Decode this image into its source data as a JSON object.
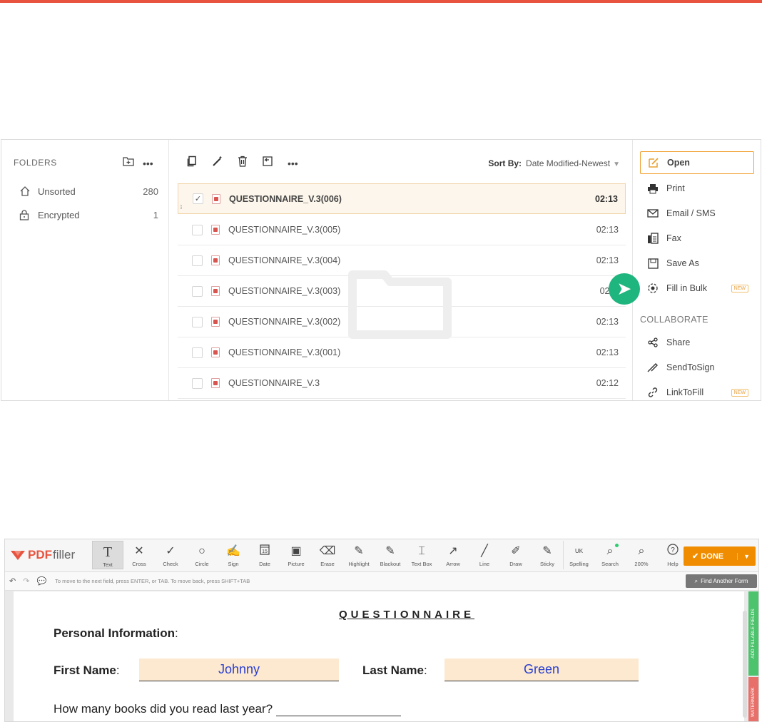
{
  "file_manager": {
    "folders_header": "FOLDERS",
    "folders": [
      {
        "icon": "home-icon",
        "label": "Unsorted",
        "count": "280"
      },
      {
        "icon": "lock-icon",
        "label": "Encrypted",
        "count": "1"
      }
    ],
    "sort_by_label": "Sort By:",
    "sort_by_value": "Date Modified-Newest",
    "files": [
      {
        "name": "QUESTIONNAIRE_V.3(006)",
        "time": "02:13",
        "selected": true
      },
      {
        "name": "QUESTIONNAIRE_V.3(005)",
        "time": "02:13",
        "selected": false
      },
      {
        "name": "QUESTIONNAIRE_V.3(004)",
        "time": "02:13",
        "selected": false
      },
      {
        "name": "QUESTIONNAIRE_V.3(003)",
        "time": "02:",
        "selected": false
      },
      {
        "name": "QUESTIONNAIRE_V.3(002)",
        "time": "02:13",
        "selected": false
      },
      {
        "name": "QUESTIONNAIRE_V.3(001)",
        "time": "02:13",
        "selected": false
      },
      {
        "name": "QUESTIONNAIRE_V.3",
        "time": "02:12",
        "selected": false
      }
    ],
    "actions": [
      {
        "icon": "edit-icon",
        "label": "Open"
      },
      {
        "icon": "print-icon",
        "label": "Print"
      },
      {
        "icon": "email-icon",
        "label": "Email / SMS"
      },
      {
        "icon": "fax-icon",
        "label": "Fax"
      },
      {
        "icon": "save-icon",
        "label": "Save As"
      },
      {
        "icon": "bulk-icon",
        "label": "Fill in Bulk",
        "badge": "NEW"
      }
    ],
    "collaborate_label": "COLLABORATE",
    "collab_actions": [
      {
        "icon": "share-icon",
        "label": "Share"
      },
      {
        "icon": "sign-icon",
        "label": "SendToSign"
      },
      {
        "icon": "link-icon",
        "label": "LinkToFill",
        "badge": "NEW"
      }
    ],
    "accent_color": "#f0a030",
    "highlight_color": "#1fb57e"
  },
  "editor": {
    "logo_pdf": "PDF",
    "logo_filler": "filler",
    "tools": [
      {
        "glyph": "T",
        "label": "Text",
        "icon": "text-icon"
      },
      {
        "glyph": "✕",
        "label": "Cross",
        "icon": "cross-icon"
      },
      {
        "glyph": "✓",
        "label": "Check",
        "icon": "check-icon"
      },
      {
        "glyph": "○",
        "label": "Circle",
        "icon": "circle-icon"
      },
      {
        "glyph": "✍",
        "label": "Sign",
        "icon": "sign-icon"
      },
      {
        "glyph": "📅",
        "label": "Date",
        "icon": "date-icon"
      },
      {
        "glyph": "▣",
        "label": "Picture",
        "icon": "picture-icon"
      },
      {
        "glyph": "⌫",
        "label": "Erase",
        "icon": "erase-icon"
      },
      {
        "glyph": "✎",
        "label": "Highlight",
        "icon": "highlight-icon"
      },
      {
        "glyph": "✎",
        "label": "Blackout",
        "icon": "blackout-icon"
      },
      {
        "glyph": "⌶",
        "label": "Text Box",
        "icon": "textbox-icon"
      },
      {
        "glyph": "↗",
        "label": "Arrow",
        "icon": "arrow-icon"
      },
      {
        "glyph": "╱",
        "label": "Line",
        "icon": "line-icon"
      },
      {
        "glyph": "✐",
        "label": "Draw",
        "icon": "draw-icon"
      },
      {
        "glyph": "✎",
        "label": "Sticky",
        "icon": "sticky-icon"
      },
      {
        "glyph": "UK",
        "label": "Spelling",
        "icon": "spelling-icon"
      },
      {
        "glyph": "⌕",
        "label": "Search",
        "icon": "search-icon"
      },
      {
        "glyph": "⌕",
        "label": "200%",
        "icon": "zoom-icon"
      },
      {
        "glyph": "?",
        "label": "Help",
        "icon": "help-icon"
      }
    ],
    "done_label": "✔ DONE",
    "hint": "To move to the next field, press ENTER, or TAB. To move back, press SHIFT+TAB",
    "find_another_form": "Find Another Form",
    "document": {
      "title": "QUESTIONNAIRE",
      "personal_info": "Personal Information",
      "first_name_label": "First Name",
      "first_name_value": "Johnny",
      "last_name_label": "Last Name",
      "last_name_value": "Green",
      "question": "How many books did you read last year?"
    },
    "side_tab_fields": "ADD FILLABLE FIELDS",
    "side_tab_watermark": "WATERMARK"
  }
}
